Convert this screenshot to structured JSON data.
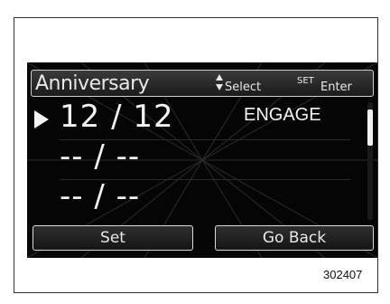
{
  "screen": {
    "title": "Anniversary",
    "hint_select": "Select",
    "hint_set": "SET",
    "hint_enter": "Enter",
    "rows": [
      {
        "date": "12 / 12",
        "tag": "ENGAGE",
        "selected": true
      },
      {
        "date": "-- / --",
        "tag": "",
        "selected": false
      },
      {
        "date": "-- / --",
        "tag": "",
        "selected": false
      }
    ],
    "buttons": {
      "set_label": "Set",
      "back_label": "Go Back"
    }
  },
  "figure_number": "302407",
  "icons": {
    "cursor": "right-triangle-cursor-icon",
    "select_arrows": "up-down-arrows-icon"
  }
}
